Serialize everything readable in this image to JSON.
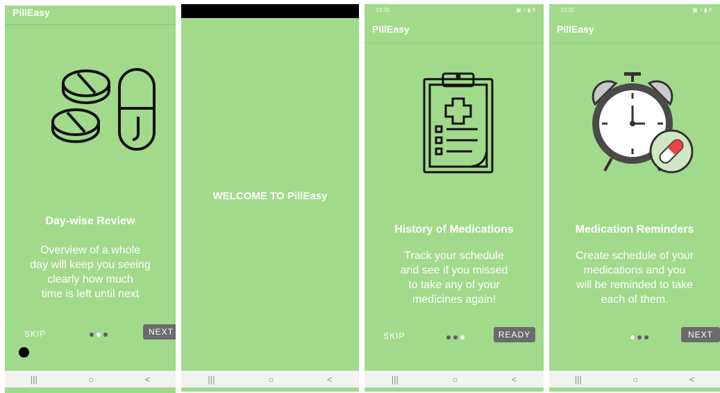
{
  "screens": [
    {
      "app_title": "PillEasy",
      "title": "Day-wise Review",
      "desc_lines": [
        "Overview of a whole",
        "day will keep you seeing",
        "clearly how much",
        "time is left until next"
      ],
      "skip_label": "SKIP",
      "next_label": "NEXT",
      "active_dot": 2
    },
    {
      "welcome": "WELCOME TO PillEasy"
    },
    {
      "status_time": "13:20",
      "app_title": "PillEasy",
      "title": "History of Medications",
      "desc_lines": [
        "Track your schedule",
        "and see if you missed",
        "to take any of your",
        "medicines again!"
      ],
      "skip_label": "SKIP",
      "ready_label": "READY",
      "active_dot": 3
    },
    {
      "status_time": "13:20",
      "app_title": "PillEasy",
      "title": "Medication Reminders",
      "desc_lines": [
        "Create schedule of your",
        "medications and you",
        "will be reminded to take",
        "each of them."
      ],
      "next_label": "NEXT",
      "active_dot": 1
    }
  ],
  "navbar": {
    "recents": "|||",
    "home": "○",
    "back": "<"
  },
  "icons": [
    "pills-icon",
    "clipboard-medical-icon",
    "alarm-clock-pill-icon"
  ],
  "colors": {
    "background": "#a2da8c",
    "button": "#6b6b6b",
    "text": "#ffffff"
  }
}
